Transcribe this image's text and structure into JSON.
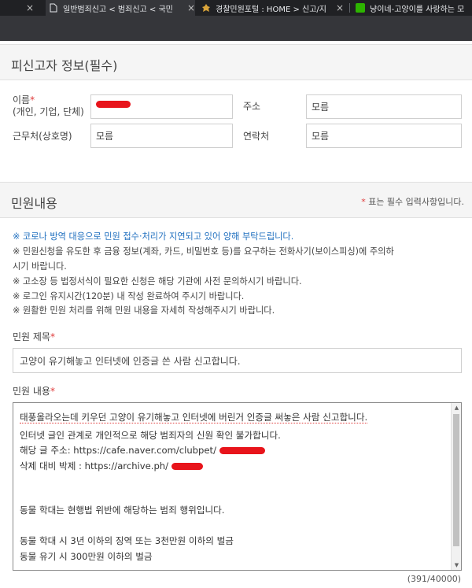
{
  "browser": {
    "tabs": [
      {
        "label": "일반범죄신고 < 범죄신고 < 국민",
        "icon": "document-icon",
        "active": true
      },
      {
        "label": "경찰민원포털 : HOME > 신고/지",
        "icon": "police-emblem-icon",
        "active": false
      },
      {
        "label": "냥이네-고양이를 사랑하는 모",
        "icon": "cafe-icon",
        "active": false
      }
    ],
    "close_glyph": "×"
  },
  "suspect_section": {
    "title": "피신고자 정보(필수)",
    "name_label": "이름",
    "name_star": "*",
    "name_sub": "(개인, 기업, 단체)",
    "address_label": "주소",
    "address_value": "모름",
    "workplace_label": "근무처(상호명)",
    "workplace_value": "모름",
    "contact_label": "연락처",
    "contact_value": "모름"
  },
  "complaint_section": {
    "title": "민원내용",
    "required_note": "표는 필수 입력사항입니다.",
    "required_star": "*",
    "notices": [
      {
        "text": "※ 코로나 방역 대응으로 민원 접수·처리가 지연되고 있어 양해 부탁드립니다.",
        "style": "blue"
      },
      {
        "text": "※ 민원신청을 유도한 후 금융 정보(계좌, 카드, 비밀번호 등)를 요구하는 전화사기(보이스피싱)에 주의하",
        "style": "normal"
      },
      {
        "text": "시기 바랍니다.",
        "style": "normal"
      },
      {
        "text": "※ 고소장 등 법정서식이 필요한 신청은 해당 기관에 사전 문의하시기 바랍니다.",
        "style": "normal"
      },
      {
        "text": "※ 로그인 유지시간(120분) 내 작성 완료하여 주시기 바랍니다.",
        "style": "normal"
      },
      {
        "text": "※ 원활한 민원 처리를 위해 민원 내용을 자세히 작성해주시기 바랍니다.",
        "style": "normal"
      }
    ],
    "subject_label": "민원 제목",
    "subject_star": "*",
    "subject_value": "고양이 유기해놓고 인터넷에 인증글 쓴 사람 신고합니다.",
    "content_label": "민원 내용",
    "content_star": "*",
    "content_lines": [
      "태풍올라오는데 키우던 고양이 유기해놓고 인터넷에 버린거 인증글 써놓은 사람 신고합니다.",
      "인터넷 글인 관계로 개인적으로 해당 범죄자의 신원 확인 불가합니다.",
      "해당 글 주소: https://cafe.naver.com/clubpet/",
      "삭제 대비 박제 : https://archive.ph/",
      "",
      "",
      "동물 학대는 현행법 위반에 해당하는 범죄 행위입니다.",
      "",
      "동물 학대 시 3년 이하의 징역 또는 3천만원 이하의 벌금",
      "동물 유기 시 300만원 이하의 벌금"
    ],
    "char_counter": "(391/40000)"
  },
  "colors": {
    "required_star": "#e03b3b",
    "notice_blue": "#1f6fbf",
    "redaction": "#e8141b"
  }
}
